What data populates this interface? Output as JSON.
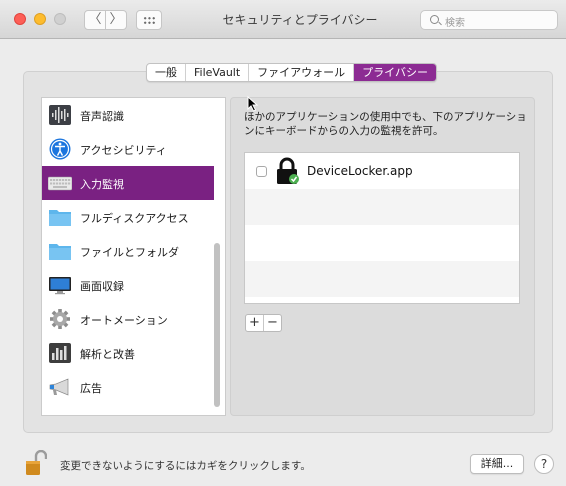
{
  "window": {
    "title": "セキュリティとプライバシー"
  },
  "toolbar": {
    "back_label": "〈",
    "forward_label": "〉",
    "search_placeholder": "検索"
  },
  "tabs": [
    {
      "label": "一般",
      "active": false
    },
    {
      "label": "FileVault",
      "active": false
    },
    {
      "label": "ファイアウォール",
      "active": false
    },
    {
      "label": "プライバシー",
      "active": true
    }
  ],
  "sidebar": {
    "items": [
      {
        "label": "音声認識",
        "icon": "waveform-icon"
      },
      {
        "label": "アクセシビリティ",
        "icon": "accessibility-icon"
      },
      {
        "label": "入力監視",
        "icon": "keyboard-icon",
        "selected": true
      },
      {
        "label": "フルディスクアクセス",
        "icon": "folder-icon"
      },
      {
        "label": "ファイルとフォルダ",
        "icon": "folder-icon"
      },
      {
        "label": "画面収録",
        "icon": "display-icon"
      },
      {
        "label": "オートメーション",
        "icon": "gear-icon"
      },
      {
        "label": "解析と改善",
        "icon": "bar-chart-icon"
      },
      {
        "label": "広告",
        "icon": "megaphone-icon"
      }
    ]
  },
  "main": {
    "description_line1": "ほかのアプリケーションの使用中でも、下のアプリケーショ",
    "description_line2": "ンにキーボードからの入力の監視を許可。",
    "apps": [
      {
        "name": "DeviceLocker.app",
        "checked": false
      }
    ],
    "add_label": "+",
    "remove_label": "−"
  },
  "footer": {
    "lock_text": "変更できないようにするにはカギをクリックします。",
    "advanced_label": "詳細...",
    "help_label": "?"
  },
  "colors": {
    "accent": "#8c2b93",
    "selected_row": "#7a2182"
  }
}
